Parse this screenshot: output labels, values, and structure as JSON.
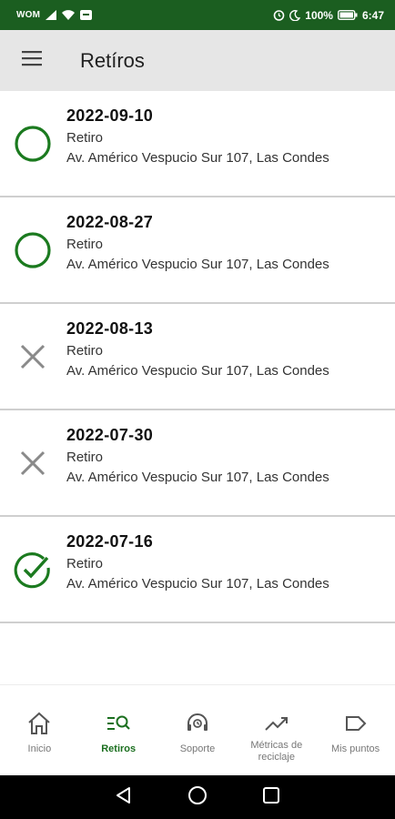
{
  "status_bar": {
    "carrier": "WOM",
    "battery": "100%",
    "time": "6:47"
  },
  "app_bar": {
    "title": "Retíros"
  },
  "colors": {
    "primary_green": "#1b5e20",
    "status_success": "#1b7a1f",
    "status_cancelled": "#8a8a8a"
  },
  "items": [
    {
      "date": "2022-09-10",
      "type": "Retiro",
      "address": "Av. Américo Vespucio Sur 107, Las Condes",
      "status_icon": "circle-pending-icon"
    },
    {
      "date": "2022-08-27",
      "type": "Retiro",
      "address": "Av. Américo Vespucio Sur 107, Las Condes",
      "status_icon": "circle-pending-icon"
    },
    {
      "date": "2022-08-13",
      "type": "Retiro",
      "address": "Av. Américo Vespucio Sur 107, Las Condes",
      "status_icon": "x-cancelled-icon"
    },
    {
      "date": "2022-07-30",
      "type": "Retiro",
      "address": "Av. Américo Vespucio Sur 107, Las Condes",
      "status_icon": "x-cancelled-icon"
    },
    {
      "date": "2022-07-16",
      "type": "Retiro",
      "address": "Av. Américo Vespucio Sur 107, Las Condes",
      "status_icon": "check-circle-icon"
    }
  ],
  "bottom_nav": [
    {
      "label": "Inicio",
      "icon": "home-icon",
      "active": false
    },
    {
      "label": "Retiros",
      "icon": "list-search-icon",
      "active": true
    },
    {
      "label": "Soporte",
      "icon": "support-headset-icon",
      "active": false
    },
    {
      "label": "Métricas de reciclaje",
      "icon": "trending-up-icon",
      "active": false
    },
    {
      "label": "Mis puntos",
      "icon": "label-tag-icon",
      "active": false
    }
  ]
}
